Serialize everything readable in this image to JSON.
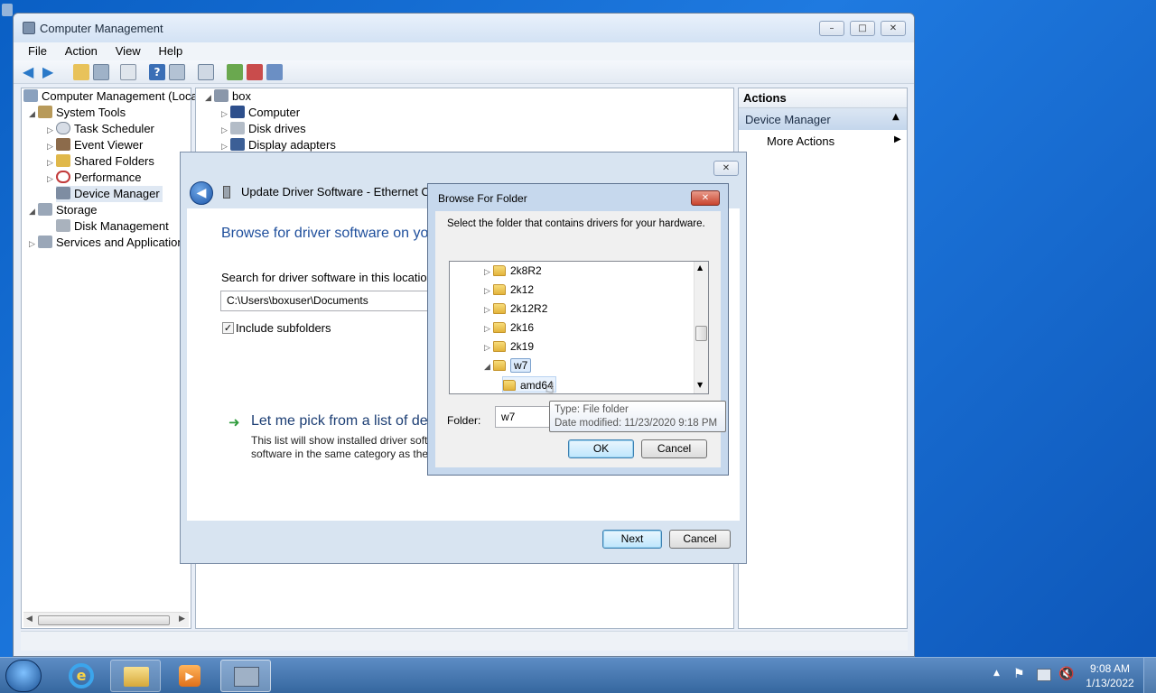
{
  "window": {
    "title": "Computer Management",
    "menu": [
      "File",
      "Action",
      "View",
      "Help"
    ]
  },
  "left_tree": [
    {
      "label": "Computer Management (Local",
      "icon": "computer-management-icon"
    },
    {
      "label": "System Tools",
      "icon": "tools-icon"
    },
    {
      "label": "Task Scheduler",
      "icon": "clock-icon"
    },
    {
      "label": "Event Viewer",
      "icon": "event-viewer-icon"
    },
    {
      "label": "Shared Folders",
      "icon": "shared-folder-icon"
    },
    {
      "label": "Performance",
      "icon": "performance-icon"
    },
    {
      "label": "Device Manager",
      "icon": "device-manager-icon"
    },
    {
      "label": "Storage",
      "icon": "storage-icon"
    },
    {
      "label": "Disk Management",
      "icon": "disk-icon"
    },
    {
      "label": "Services and Applications",
      "icon": "services-icon"
    }
  ],
  "device_tree": {
    "root": "box",
    "items": [
      "Computer",
      "Disk drives",
      "Display adapters"
    ]
  },
  "actions": {
    "header": "Actions",
    "section": "Device Manager",
    "more": "More Actions"
  },
  "wizard": {
    "title": "Update Driver Software - Ethernet Cont",
    "heading": "Browse for driver software on yo",
    "search_label": "Search for driver software in this location:",
    "path": "C:\\Users\\boxuser\\Documents",
    "include_subfolders": "Include subfolders",
    "pick_title": "Let me pick from a list of dev",
    "pick_desc_1": "This list will show installed driver soft",
    "pick_desc_2": "software in the same category as the",
    "next": "Next",
    "cancel": "Cancel"
  },
  "browse": {
    "title": "Browse For Folder",
    "instruction": "Select the folder that contains drivers for your hardware.",
    "folders": [
      "2k8R2",
      "2k12",
      "2k12R2",
      "2k16",
      "2k19",
      "w7",
      "amd64"
    ],
    "folder_label": "Folder:",
    "folder_value": "w7",
    "tooltip_type": "Type: File folder",
    "tooltip_date": "Date modified: 11/23/2020 9:18 PM",
    "ok": "OK",
    "cancel": "Cancel"
  },
  "taskbar": {
    "time": "9:08 AM",
    "date": "1/13/2022"
  }
}
